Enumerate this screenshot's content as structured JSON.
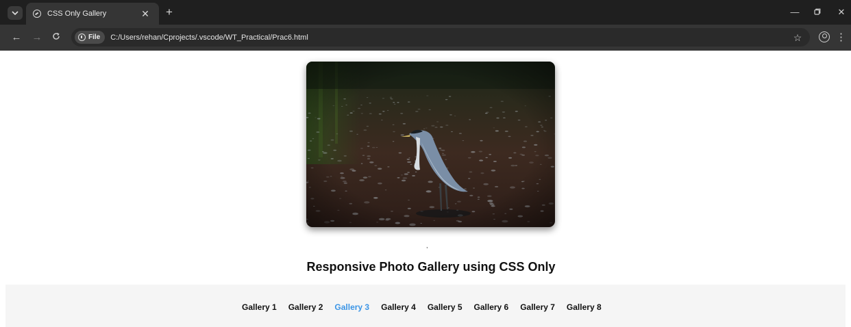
{
  "browser": {
    "tab_title": "CSS Only Gallery",
    "address_chip": "File",
    "url": "C:/Users/rehan/Cprojects/.vscode/WT_Practical/Prac6.html"
  },
  "page": {
    "caption": ",",
    "heading": "Responsive Photo Gallery using CSS Only",
    "nav": [
      "Gallery 1",
      "Gallery 2",
      "Gallery 3",
      "Gallery 4",
      "Gallery 5",
      "Gallery 6",
      "Gallery 7",
      "Gallery 8"
    ],
    "active_nav": "Gallery 3",
    "colors": {
      "active_link": "#3b95e6",
      "nav_bg": "#f5f5f5"
    }
  }
}
